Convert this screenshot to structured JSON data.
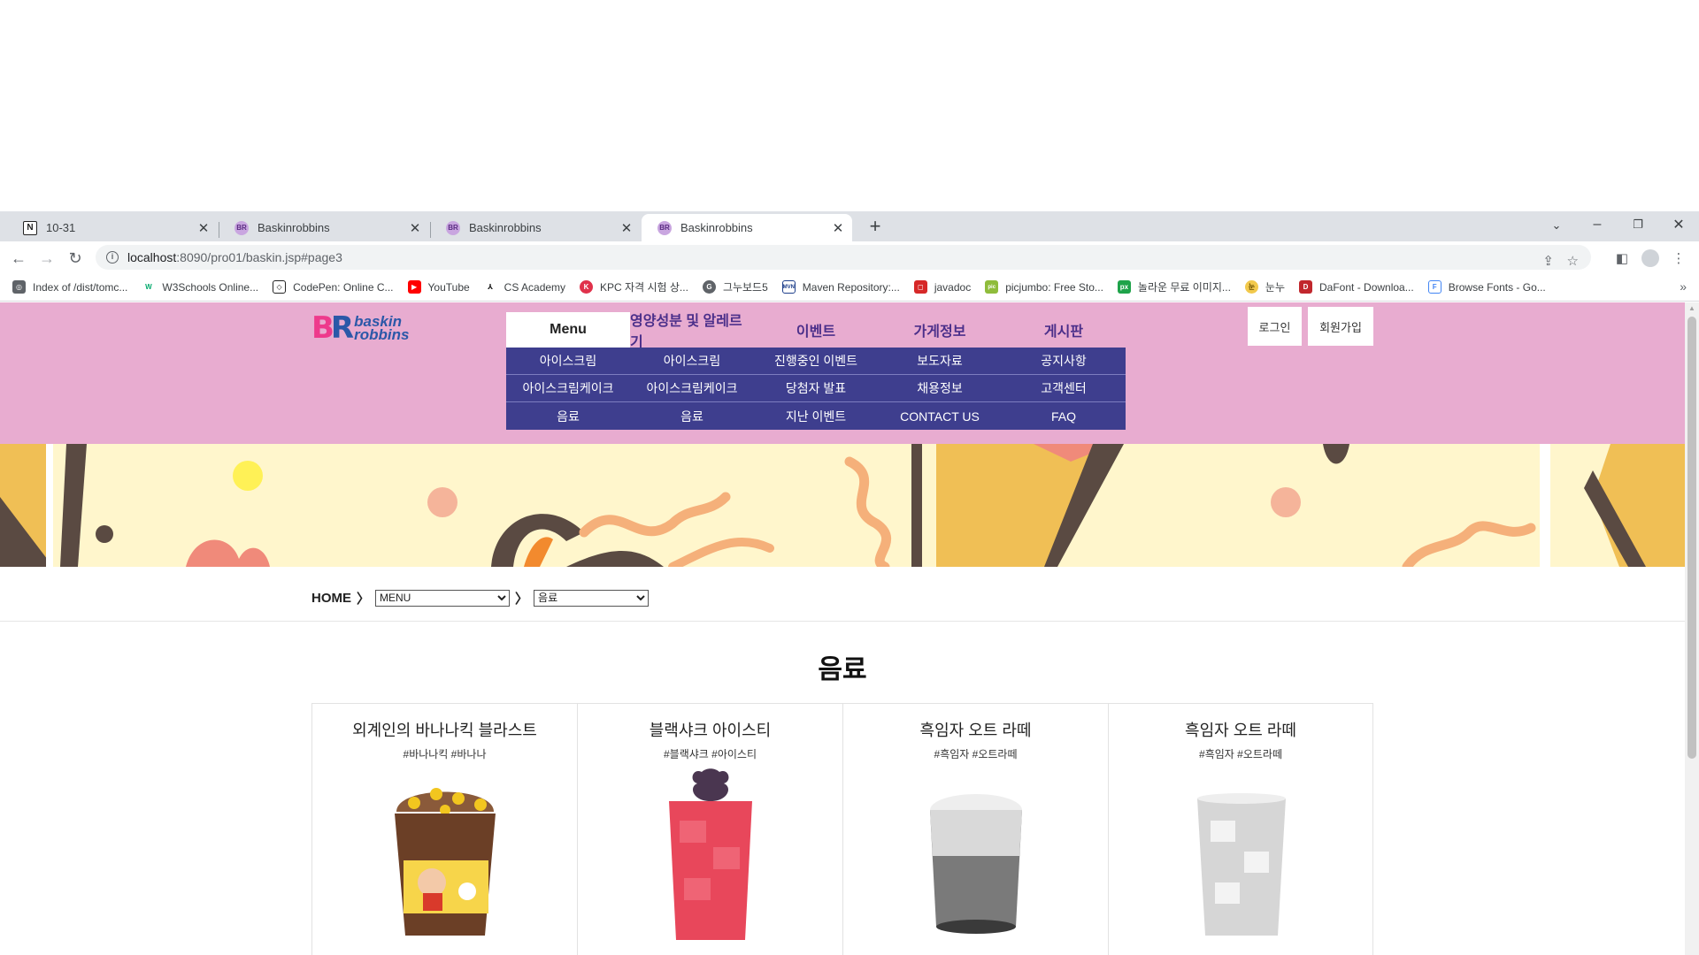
{
  "browser": {
    "tabs": [
      {
        "title": "10-31",
        "favicon": "notion-icon"
      },
      {
        "title": "Baskinrobbins",
        "favicon": "baskin-favicon"
      },
      {
        "title": "Baskinrobbins",
        "favicon": "baskin-favicon"
      },
      {
        "title": "Baskinrobbins",
        "favicon": "baskin-favicon",
        "active": true
      }
    ],
    "new_tab": "+",
    "window_controls": {
      "minimize": "–",
      "restore": "❐",
      "close": "✕"
    },
    "url_host": "localhost",
    "url_rest": ":8090/pro01/baskin.jsp#page3",
    "bookmarks": [
      "Index of /dist/tomc...",
      "W3Schools Online...",
      "CodePen: Online C...",
      "YouTube",
      "CS Academy",
      "KPC 자격 시험 상...",
      "그누보드5",
      "Maven Repository:...",
      "javadoc",
      "picjumbo: Free Sto...",
      "놀라운 무료 이미지...",
      "눈누",
      "DaFont - Downloa...",
      "Browse Fonts - Go..."
    ],
    "bookmarks_more": "»"
  },
  "site": {
    "logo_text_1": "baskin",
    "logo_text_2": "robbins",
    "nav": [
      "Menu",
      "영양성분 및 알레르기",
      "이벤트",
      "가게정보",
      "게시판"
    ],
    "submenu": [
      [
        "아이스크림",
        "아이스크림",
        "진행중인 이벤트",
        "보도자료",
        "공지사항"
      ],
      [
        "아이스크림케이크",
        "아이스크림케이크",
        "당첨자 발표",
        "채용정보",
        "고객센터"
      ],
      [
        "음료",
        "음료",
        "지난 이벤트",
        "CONTACT US",
        "FAQ"
      ]
    ],
    "login": "로그인",
    "signup": "회원가입",
    "breadcrumb": {
      "home": "HOME",
      "arrow": "〉",
      "select1": "MENU",
      "select2": "음료"
    },
    "page_title": "음료",
    "products": [
      {
        "name": "외계인의 바나나킥 블라스트",
        "tags": "#바나나킥 #바나나"
      },
      {
        "name": "블랙샤크 아이스티",
        "tags": "#블랙샤크 #아이스티"
      },
      {
        "name": "흑임자 오트 라떼",
        "tags": "#흑임자 #오트라떼"
      },
      {
        "name": "흑임자 오트 라떼",
        "tags": "#흑임자 #오트라떼"
      }
    ]
  },
  "colors": {
    "header_bg": "#e8acd0",
    "nav_text": "#4b2f8a",
    "submenu_bg": "#3e3e8e",
    "banner_bg": "#fff6cc"
  }
}
